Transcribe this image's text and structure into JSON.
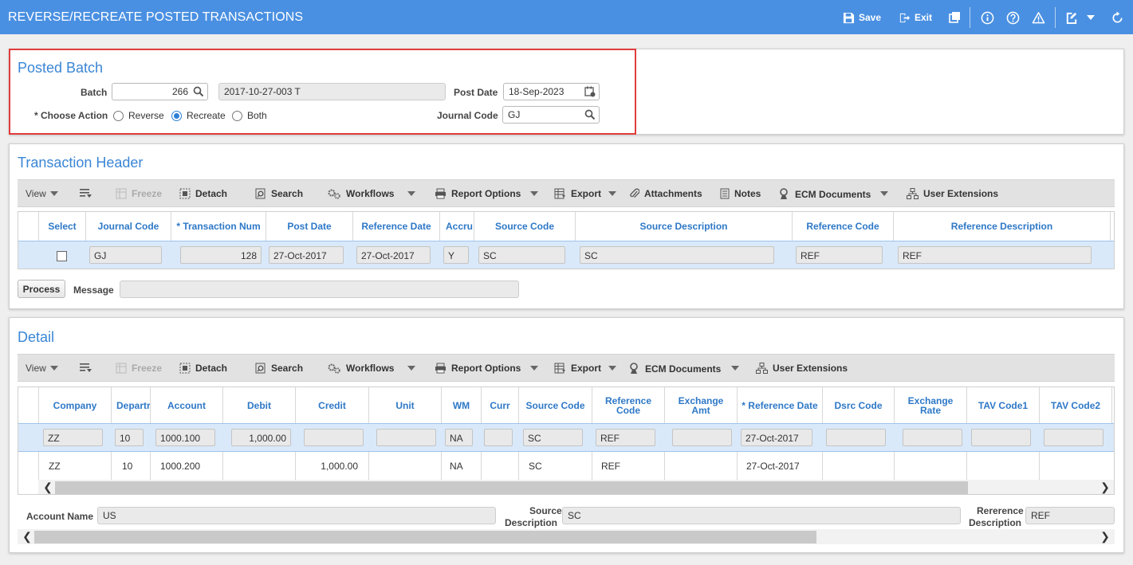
{
  "window": {
    "title": "REVERSE/RECREATE POSTED TRANSACTIONS",
    "save_label": "Save",
    "exit_label": "Exit"
  },
  "posted_batch": {
    "title": "Posted Batch",
    "batch_label": "Batch",
    "batch_value": "266",
    "batch_desc": "2017-10-27-003 T",
    "post_date_label": "Post Date",
    "post_date_value": "18-Sep-2023",
    "choose_action_label": "* Choose Action",
    "actions": [
      "Reverse",
      "Recreate",
      "Both"
    ],
    "selected_action": "Recreate",
    "journal_code_label": "Journal Code",
    "journal_code_value": "GJ"
  },
  "transaction_header": {
    "title": "Transaction Header",
    "toolbar": {
      "view": "View",
      "freeze": "Freeze",
      "detach": "Detach",
      "search": "Search",
      "workflows": "Workflows",
      "report_options": "Report Options",
      "export": "Export",
      "attachments": "Attachments",
      "notes": "Notes",
      "ecm_documents": "ECM Documents",
      "user_extensions": "User Extensions"
    },
    "columns": [
      "Select",
      "Journal Code",
      "* Transaction Num",
      "Post Date",
      "Reference Date",
      "Accru",
      "Source Code",
      "Source Description",
      "Reference Code",
      "Reference Description"
    ],
    "row": {
      "journal_code": "GJ",
      "transaction_num": "128",
      "post_date": "27-Oct-2017",
      "reference_date": "27-Oct-2017",
      "accrual": "Y",
      "source_code": "SC",
      "source_description": "SC",
      "reference_code": "REF",
      "reference_description": "REF"
    },
    "process_label": "Process",
    "message_label": "Message",
    "message_value": ""
  },
  "detail": {
    "title": "Detail",
    "toolbar": {
      "view": "View",
      "freeze": "Freeze",
      "detach": "Detach",
      "search": "Search",
      "workflows": "Workflows",
      "report_options": "Report Options",
      "export": "Export",
      "ecm_documents": "ECM Documents",
      "user_extensions": "User Extensions"
    },
    "columns": [
      "Company",
      "Departr",
      "Account",
      "Debit",
      "Credit",
      "Unit",
      "WM",
      "Curr",
      "Source Code",
      "Reference Code",
      "Exchange Amt",
      "* Reference Date",
      "Dsrc Code",
      "Exchange Rate",
      "TAV Code1",
      "TAV Code2"
    ],
    "rows": [
      {
        "company": "ZZ",
        "department": "10",
        "account": "1000.100",
        "debit": "1,000.00",
        "credit": "",
        "unit": "",
        "wm": "NA",
        "curr": "",
        "source_code": "SC",
        "reference_code": "REF",
        "exchange_amt": "",
        "reference_date": "27-Oct-2017",
        "dsrc_code": "",
        "exchange_rate": "",
        "tav1": "",
        "tav2": ""
      },
      {
        "company": "ZZ",
        "department": "10",
        "account": "1000.200",
        "debit": "",
        "credit": "1,000.00",
        "unit": "",
        "wm": "NA",
        "curr": "",
        "source_code": "SC",
        "reference_code": "REF",
        "exchange_amt": "",
        "reference_date": "27-Oct-2017",
        "dsrc_code": "",
        "exchange_rate": "",
        "tav1": "",
        "tav2": ""
      }
    ],
    "account_name_label": "Account Name",
    "account_name_value": "US",
    "source_desc_label_1": "Source",
    "source_desc_label_2": "Description",
    "source_desc_value": "SC",
    "ref_desc_label_1": "Rererence",
    "ref_desc_label_2": "Description",
    "ref_desc_value": "REF"
  }
}
